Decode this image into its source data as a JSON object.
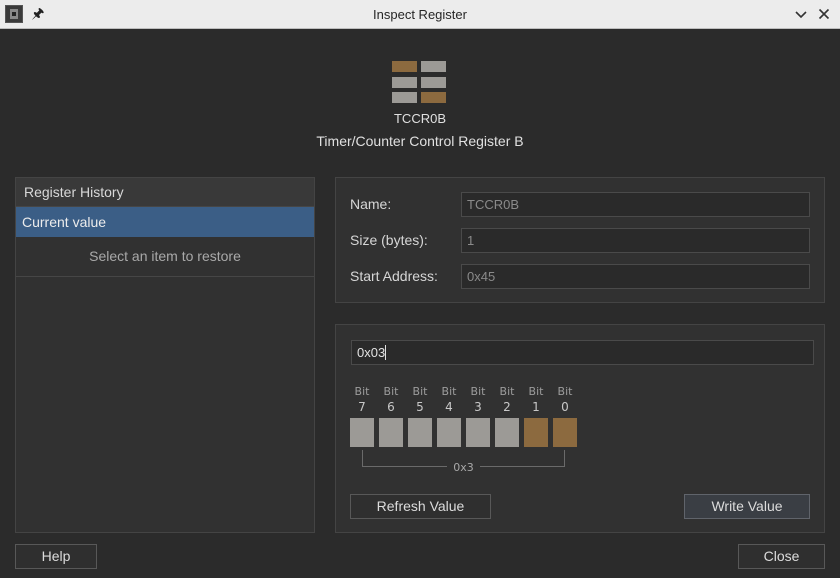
{
  "window": {
    "title": "Inspect Register"
  },
  "register": {
    "name": "TCCR0B",
    "description": "Timer/Counter Control Register B"
  },
  "history": {
    "header": "Register History",
    "current_item": "Current value",
    "hint": "Select an item to restore"
  },
  "info": {
    "name_label": "Name:",
    "name_value": "TCCR0B",
    "size_label": "Size (bytes):",
    "size_value": "1",
    "address_label": "Start Address:",
    "address_value": "0x45"
  },
  "value": {
    "text": "0x03",
    "bit_label": "Bit",
    "bits": [
      {
        "index": "7",
        "set": false
      },
      {
        "index": "6",
        "set": false
      },
      {
        "index": "5",
        "set": false
      },
      {
        "index": "4",
        "set": false
      },
      {
        "index": "3",
        "set": false
      },
      {
        "index": "2",
        "set": false
      },
      {
        "index": "1",
        "set": true
      },
      {
        "index": "0",
        "set": true
      }
    ],
    "nibble_label": "0x3",
    "refresh_label": "Refresh Value",
    "write_label": "Write Value"
  },
  "footer": {
    "help_label": "Help",
    "close_label": "Close"
  },
  "colors": {
    "bit_set": "#8c6a3f",
    "bit_clear": "#9c9a96",
    "selection": "#3b5e86"
  },
  "icons": {
    "app": "app-icon",
    "pin": "pin-icon",
    "minimize": "chevron-down-icon",
    "close": "close-icon",
    "register": "register-icon"
  }
}
